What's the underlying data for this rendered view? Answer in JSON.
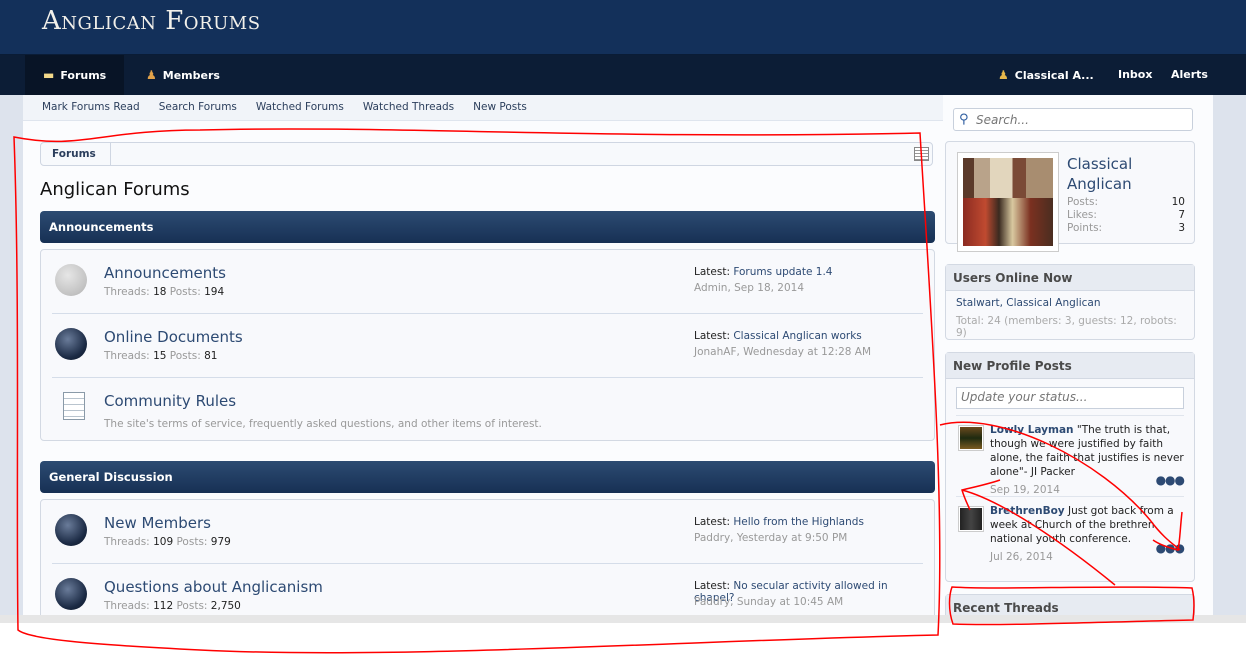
{
  "site": {
    "title": "Anglican Forums"
  },
  "nav": {
    "tabs": [
      {
        "label": "Forums",
        "icon": "speech-bubble-icon"
      },
      {
        "label": "Members",
        "icon": "members-icon"
      }
    ],
    "user": "Classical A...",
    "inbox": "Inbox",
    "alerts": "Alerts"
  },
  "subnav": [
    "Mark Forums Read",
    "Search Forums",
    "Watched Forums",
    "Watched Threads",
    "New Posts"
  ],
  "breadcrumb": "Forums",
  "page_title": "Anglican Forums",
  "categories": [
    {
      "title": "Announcements",
      "forums": [
        {
          "name": "Announcements",
          "threads": "18",
          "posts": "194",
          "latest": "Forums update 1.4",
          "meta": "Admin, Sep 18, 2014",
          "read": true
        },
        {
          "name": "Online Documents",
          "threads": "15",
          "posts": "81",
          "latest": "Classical Anglican works",
          "meta": "JonahAF, Wednesday at 12:28 AM"
        },
        {
          "name": "Community Rules",
          "desc": "The site's terms of service, frequently asked questions, and other items of interest."
        }
      ]
    },
    {
      "title": "General Discussion",
      "forums": [
        {
          "name": "New Members",
          "threads": "109",
          "posts": "979",
          "latest": "Hello from the Highlands",
          "meta": "Paddry, Yesterday at 9:50 PM"
        },
        {
          "name": "Questions about Anglicanism",
          "threads": "112",
          "posts": "2,750",
          "latest": "No secular activity allowed in chapel?",
          "meta": "Paddry, Sunday at 10:45 AM"
        }
      ]
    }
  ],
  "labels": {
    "threads": "Threads:",
    "posts": "Posts:",
    "latest": "Latest:"
  },
  "search": {
    "placeholder": "Search..."
  },
  "profile": {
    "name": "Classical Anglican",
    "stats": [
      {
        "label": "Posts:",
        "value": "10"
      },
      {
        "label": "Likes:",
        "value": "7"
      },
      {
        "label": "Points:",
        "value": "3"
      }
    ]
  },
  "online": {
    "title": "Users Online Now",
    "users": "Stalwart, Classical Anglican",
    "total": "Total: 24 (members: 3, guests: 12, robots: 9)"
  },
  "profile_posts": {
    "title": "New Profile Posts",
    "placeholder": "Update your status...",
    "posts": [
      {
        "user": "Lowly Layman",
        "text": "\"The truth is that, though we were justified by faith alone, the faith that justifies is never alone\"- JI Packer",
        "date": "Sep 19, 2014"
      },
      {
        "user": "BrethrenBoy",
        "text": "Just got back from a week at Church of the brethren national youth conference.",
        "date": "Jul 26, 2014"
      }
    ]
  },
  "recent_threads": {
    "title": "Recent Threads"
  },
  "colors": {
    "header": "#13305a",
    "navbar": "#0c1d36",
    "link": "#2d4a73",
    "annotation": "#ff0000"
  }
}
